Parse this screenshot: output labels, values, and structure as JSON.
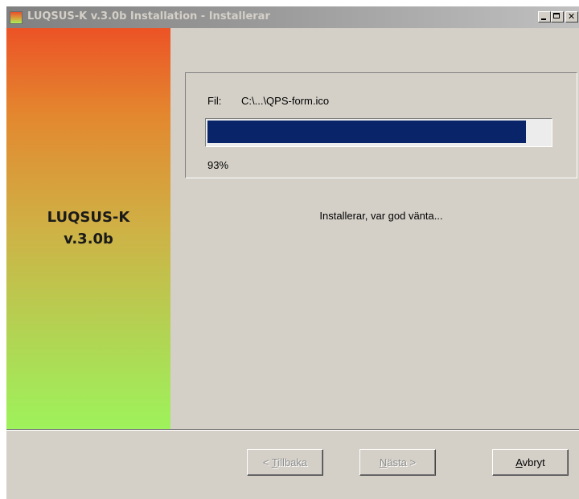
{
  "window": {
    "title": "LUQSUS-K v.3.0b Installation - Installerar"
  },
  "sidebar": {
    "title_line1": "LUQSUS-K",
    "title_line2": "v.3.0b"
  },
  "progress": {
    "file_label": "Fil:",
    "file_path": "C:\\...\\QPS-form.ico",
    "percent_text": "93%",
    "fraction": 0.93
  },
  "status": {
    "message": "Installerar, var god vänta..."
  },
  "buttons": {
    "back": {
      "prefix": "< ",
      "accel": "T",
      "rest": "illbaka",
      "enabled": false
    },
    "next": {
      "accel": "N",
      "rest": "ästa >",
      "enabled": false
    },
    "cancel": {
      "accel": "A",
      "rest": "vbryt",
      "enabled": true
    }
  },
  "colors": {
    "progress_fill": "#0a246a",
    "dialog_bg": "#d4d0c8",
    "titlebar_inactive": "#808080"
  },
  "icons": {
    "app": "installer-icon",
    "minimize": "minimize-icon",
    "maximize": "maximize-icon",
    "close": "close-icon"
  }
}
